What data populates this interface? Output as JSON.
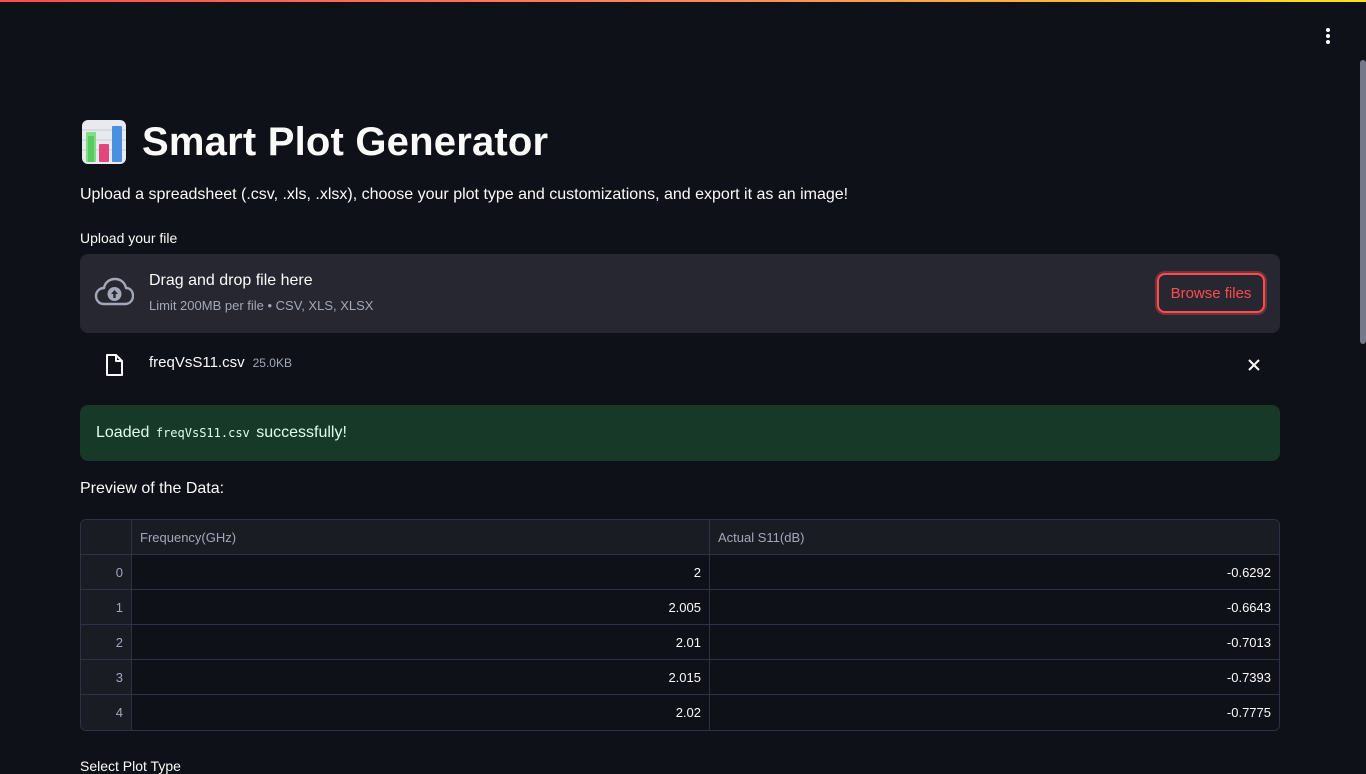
{
  "app": {
    "title": "Smart Plot Generator",
    "subtitle": "Upload a spreadsheet (.csv, .xls, .xlsx), choose your plot type and customizations, and export it as an image!",
    "title_icon": "bar-chart-emoji-icon",
    "accent_color": "#ff4b4b"
  },
  "uploader": {
    "label": "Upload your file",
    "drop_title": "Drag and drop file here",
    "drop_limit": "Limit 200MB per file • CSV, XLS, XLSX",
    "browse_label": "Browse files",
    "icon": "cloud-upload-icon"
  },
  "file": {
    "name": "freqVsS11.csv",
    "size": "25.0KB",
    "icon": "file-icon",
    "remove_icon": "close-icon"
  },
  "success": {
    "prefix": "Loaded",
    "filename": "freqVsS11.csv",
    "suffix": "successfully!",
    "color": "#173928"
  },
  "preview": {
    "label": "Preview of the Data:",
    "columns": [
      "",
      "Frequency(GHz)",
      "Actual S11(dB)"
    ],
    "rows": [
      {
        "index": "0",
        "freq": "2",
        "s11": "-0.6292"
      },
      {
        "index": "1",
        "freq": "2.005",
        "s11": "-0.6643"
      },
      {
        "index": "2",
        "freq": "2.01",
        "s11": "-0.7013"
      },
      {
        "index": "3",
        "freq": "2.015",
        "s11": "-0.7393"
      },
      {
        "index": "4",
        "freq": "2.02",
        "s11": "-0.7775"
      }
    ]
  },
  "plot_type": {
    "label": "Select Plot Type"
  },
  "menu": {
    "icon": "more-vertical-icon"
  }
}
